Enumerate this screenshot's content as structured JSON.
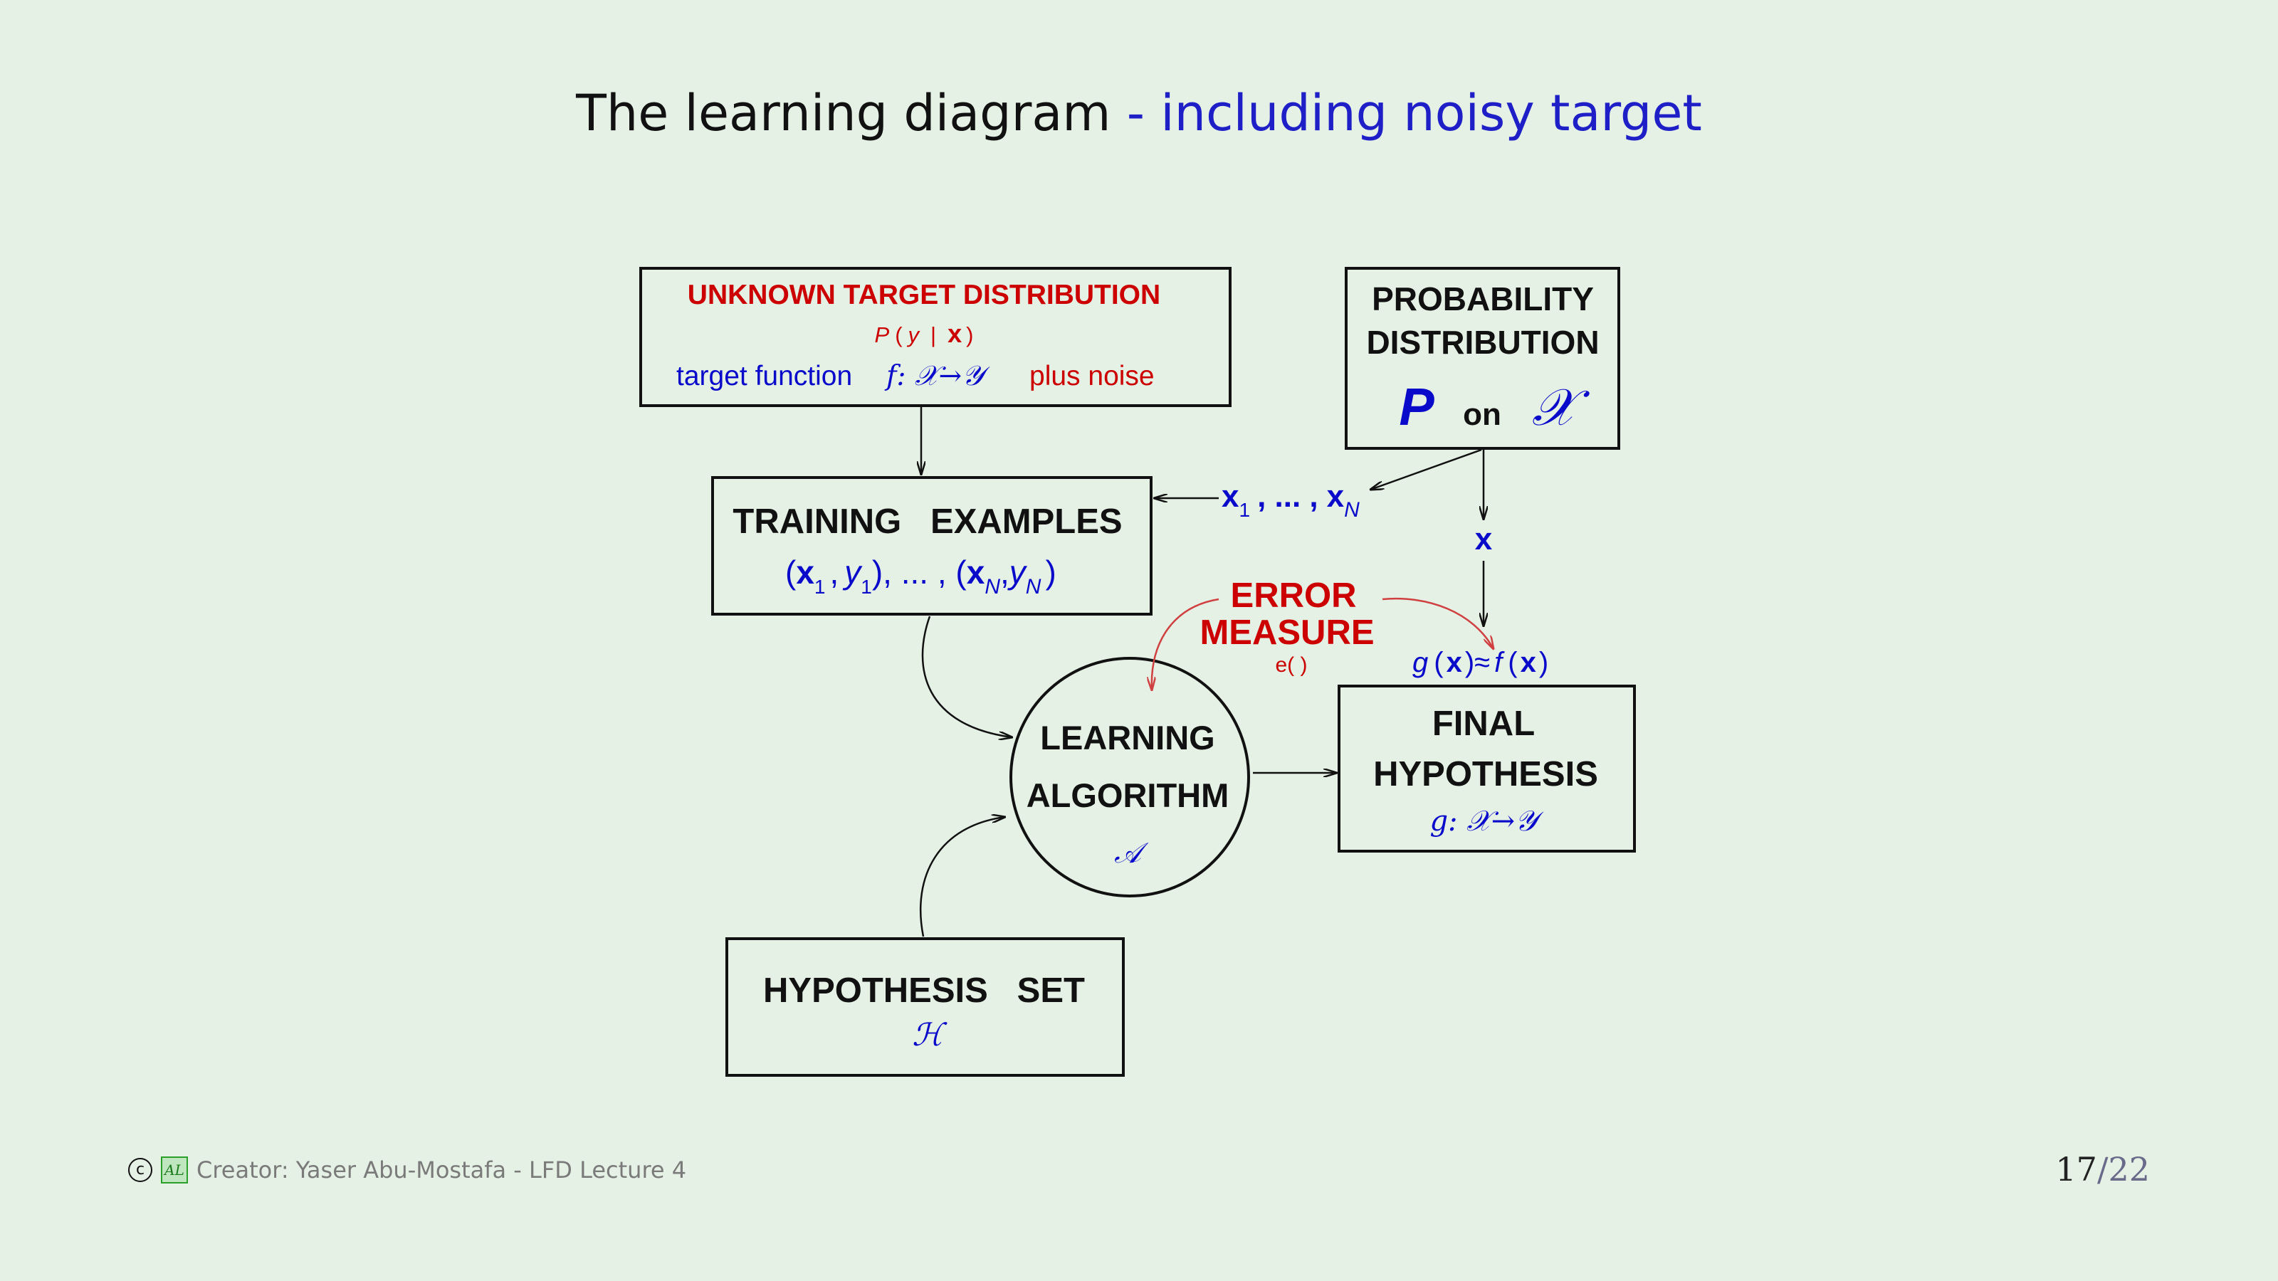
{
  "title": {
    "main": "The learning diagram",
    "sub": "- including noisy target"
  },
  "colors": {
    "blue": "#0a0acb",
    "red": "#cc0000",
    "black": "#111111",
    "background": "#e5f1e5"
  },
  "boxes": {
    "target": {
      "heading": "UNKNOWN TARGET DISTRIBUTION",
      "formula_p": "P",
      "formula_open": "(",
      "formula_y": "y",
      "formula_bar": "|",
      "formula_x": "x",
      "formula_close": ")",
      "target_label": "target function",
      "target_formula": "f: 𝒳→𝒴",
      "noise_label": "plus noise"
    },
    "probability": {
      "line1": "PROBABILITY",
      "line2": "DISTRIBUTION",
      "p_symbol": "P",
      "on_label": "on",
      "x_symbol": "𝒳"
    },
    "training": {
      "heading": "TRAINING   EXAMPLES",
      "open1": "(",
      "x1": "x",
      "sub1": "1",
      "comma": ",",
      "y1": "y",
      "sub1b": "1",
      "mid": "), ... , (",
      "xN": "x",
      "subN": "N",
      "yN": "y",
      "subNb": "N",
      "close": ")"
    },
    "hypothesis_set": {
      "heading": "HYPOTHESIS   SET",
      "symbol": "ℋ"
    },
    "learning": {
      "line1": "LEARNING",
      "line2": "ALGORITHM",
      "symbol": "𝒜"
    },
    "final": {
      "line1": "FINAL",
      "line2": "HYPOTHESIS",
      "formula": "g: 𝒳→𝒴"
    }
  },
  "labels": {
    "samples": {
      "x1": "x",
      "sub1": "1",
      "mid": ", ... ,",
      "xN": "x",
      "subN": "N"
    },
    "single_x": "x",
    "error": {
      "line1": "ERROR",
      "line2": "MEASURE",
      "func": "e( )"
    },
    "approx": {
      "g": "g",
      "lp": "(",
      "x": "x",
      "rp": ")",
      "approx": "≈",
      "f": "f",
      "lp2": "(",
      "x2": "x",
      "rp2": ")"
    }
  },
  "footer": {
    "copyright_icon": "copyright-icon",
    "logo_icon": "amlbook-logo-icon",
    "creator": "Creator:  Yaser Abu-Mostafa - LFD Lecture 4",
    "page_current": "17",
    "page_sep": "/",
    "page_total": "22"
  }
}
